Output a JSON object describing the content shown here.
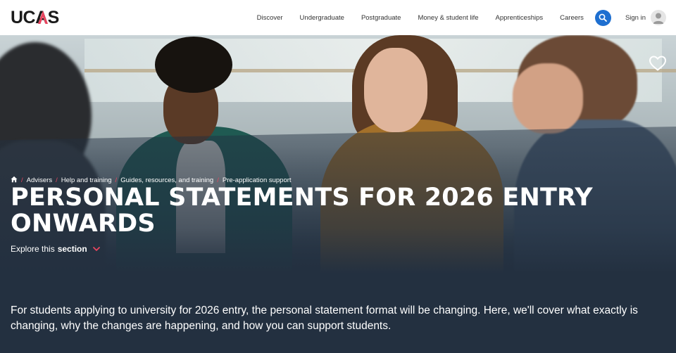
{
  "header": {
    "logo_text": "UCAS",
    "nav": [
      "Discover",
      "Undergraduate",
      "Postgraduate",
      "Money & student life",
      "Apprenticeships",
      "Careers"
    ],
    "sign_in_label": "Sign in",
    "accent_color": "#1e6fd0",
    "icons": [
      "search-icon",
      "user-avatar-icon"
    ]
  },
  "hero": {
    "breadcrumb": [
      "Advisers",
      "Help and training",
      "Guides, resources, and training",
      "Pre-application support"
    ],
    "title": "PERSONAL STATEMENTS FOR 2026 ENTRY ONWARDS",
    "explore_prefix": "Explore this",
    "explore_bold": "section",
    "accent_color": "#e8455f",
    "icons": [
      "home-icon",
      "heart-icon",
      "chevron-down-icon"
    ]
  },
  "intro": {
    "text": "For students applying to university for 2026 entry, the personal statement format will be changing. Here, we'll cover what exactly is changing, why the changes are happening, and how you can support students."
  }
}
